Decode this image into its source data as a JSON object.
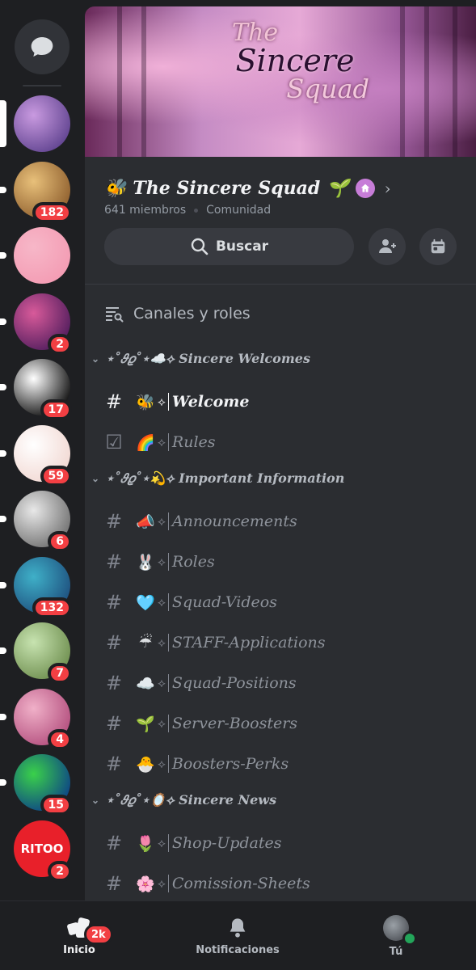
{
  "server": {
    "name": "The Sincere Squad",
    "name_emoji_left": "🐝",
    "name_emoji_right": "🌱",
    "members": "641 miembros",
    "type": "Comunidad",
    "banner": {
      "line1": "The",
      "line2": "Sincere",
      "line3": "Squad"
    }
  },
  "actions": {
    "search_label": "Buscar"
  },
  "channels_roles_label": "Canales y roles",
  "rail": {
    "servers": [
      {
        "badge": "",
        "selected": true,
        "unread": false,
        "colors": [
          "#c99ae0",
          "#5b3f8c"
        ]
      },
      {
        "badge": "182",
        "selected": false,
        "unread": true,
        "colors": [
          "#e8c07a",
          "#8a5a2a"
        ]
      },
      {
        "badge": "",
        "selected": false,
        "unread": true,
        "colors": [
          "#f7b7c8",
          "#f39ab2"
        ]
      },
      {
        "badge": "2",
        "selected": false,
        "unread": true,
        "colors": [
          "#d85a9a",
          "#4a1a5a"
        ]
      },
      {
        "badge": "17",
        "selected": false,
        "unread": true,
        "colors": [
          "#ffffff",
          "#000000"
        ]
      },
      {
        "badge": "59",
        "selected": false,
        "unread": true,
        "colors": [
          "#ffffff",
          "#f1d6d0"
        ]
      },
      {
        "badge": "6",
        "selected": false,
        "unread": true,
        "colors": [
          "#e8e8e8",
          "#6a6a6a"
        ]
      },
      {
        "badge": "132",
        "selected": false,
        "unread": true,
        "colors": [
          "#3fb0c8",
          "#1c4a7a"
        ]
      },
      {
        "badge": "7",
        "selected": false,
        "unread": true,
        "colors": [
          "#c7e3b0",
          "#6a8a4a"
        ]
      },
      {
        "badge": "4",
        "selected": false,
        "unread": true,
        "colors": [
          "#f0b0c8",
          "#b04a7a"
        ]
      },
      {
        "badge": "15",
        "selected": false,
        "unread": true,
        "colors": [
          "#3ad14a",
          "#0a3a8a"
        ]
      },
      {
        "badge": "2",
        "selected": false,
        "unread": false,
        "colors": [
          "#e8202a",
          "#e8202a"
        ],
        "text": "RITOO"
      }
    ]
  },
  "categories": [
    {
      "label": "⋆˚𝜗𝜚˚⋆☁️⟡ Sincere Welcomes",
      "channels": [
        {
          "icon": "#",
          "emoji": "🐝",
          "name": "Welcome",
          "active": true
        },
        {
          "icon": "☑",
          "emoji": "🌈",
          "name": "Rules",
          "active": false
        }
      ]
    },
    {
      "label": "⋆˚𝜗𝜚˚⋆💫⟡ Important Information",
      "channels": [
        {
          "icon": "#",
          "emoji": "📣",
          "name": "Announcements",
          "active": false
        },
        {
          "icon": "#",
          "emoji": "🐰",
          "name": "Roles",
          "active": false
        },
        {
          "icon": "#",
          "emoji": "🩵",
          "name": "Squad-Videos",
          "active": false
        },
        {
          "icon": "#",
          "emoji": "☔",
          "name": "STAFF-Applications",
          "active": false
        },
        {
          "icon": "#",
          "emoji": "☁️",
          "name": "Squad-Positions",
          "active": false
        },
        {
          "icon": "#",
          "emoji": "🌱",
          "name": "Server-Boosters",
          "active": false
        },
        {
          "icon": "#",
          "emoji": "🐣",
          "name": "Boosters-Perks",
          "active": false
        }
      ]
    },
    {
      "label": "⋆˚𝜗𝜚˚⋆🪞⟡ Sincere News",
      "channels": [
        {
          "icon": "#",
          "emoji": "🌷",
          "name": "Shop-Updates",
          "active": false
        },
        {
          "icon": "#",
          "emoji": "🌸",
          "name": "Comission-Sheets",
          "active": false
        }
      ]
    }
  ],
  "nav": {
    "home": {
      "label": "Inicio",
      "badge": "2k"
    },
    "notifications": {
      "label": "Notificaciones"
    },
    "you": {
      "label": "Tú"
    }
  },
  "colors": {
    "accent_red": "#f23f43",
    "online": "#23a55a",
    "panel": "#2b2d31",
    "rail": "#1e1f22"
  }
}
